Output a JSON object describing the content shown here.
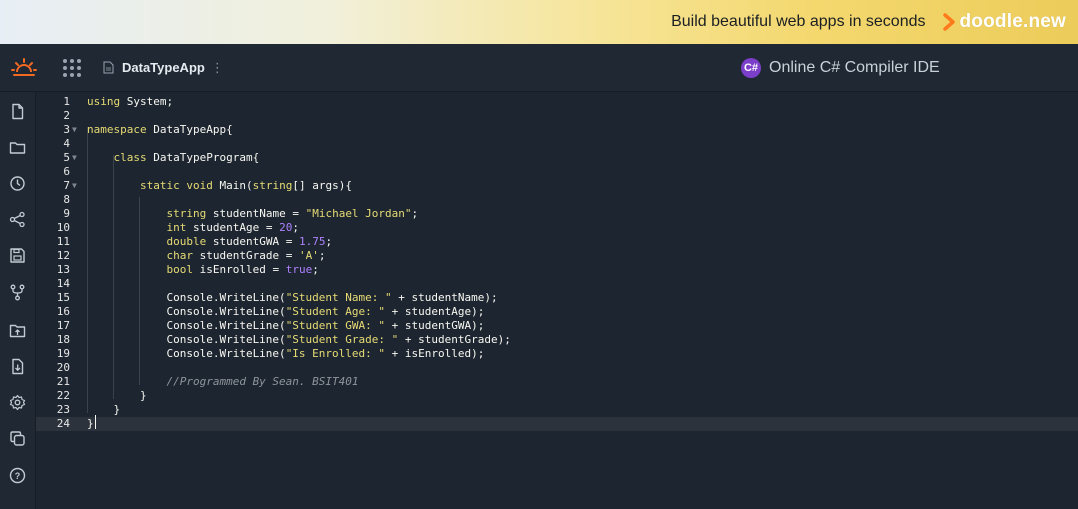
{
  "banner": {
    "text": "Build beautiful web apps in seconds",
    "brand": "doodle.new"
  },
  "header": {
    "file_name": "DataTypeApp",
    "kebab": "⋮",
    "ide_title": "Online C# Compiler IDE",
    "lang_badge": "C#"
  },
  "sidebar": {
    "icons": [
      "file-icon",
      "folder-icon",
      "history-icon",
      "share-icon",
      "save-icon",
      "fork-icon",
      "upload-folder-icon",
      "download-icon",
      "settings-icon",
      "copy-icon",
      "help-icon"
    ]
  },
  "editor": {
    "active_line": 24,
    "lines": [
      "using System;",
      "",
      "namespace DataTypeApp{",
      "",
      "    class DataTypeProgram{",
      "",
      "        static void Main(string[] args){",
      "",
      "            string studentName = \"Michael Jordan\";",
      "            int studentAge = 20;",
      "            double studentGWA = 1.75;",
      "            char studentGrade = 'A';",
      "            bool isEnrolled = true;",
      "",
      "            Console.WriteLine(\"Student Name: \" + studentName);",
      "            Console.WriteLine(\"Student Age: \" + studentAge);",
      "            Console.WriteLine(\"Student GWA: \" + studentGWA);",
      "            Console.WriteLine(\"Student Grade: \" + studentGrade);",
      "            Console.WriteLine(\"Is Enrolled: \" + isEnrolled);",
      "",
      "            //Programmed By Sean. BSIT401",
      "        }",
      "    }",
      "}"
    ],
    "foldable_lines": [
      3,
      5,
      7
    ]
  },
  "colors": {
    "banner_from": "#e7eef5",
    "banner_to": "#eccc5a",
    "header_bg": "#1f2833",
    "editor_bg": "#1d2530",
    "csharp_purple": "#7b3fc9",
    "brand_orange": "#ff7a1a"
  }
}
